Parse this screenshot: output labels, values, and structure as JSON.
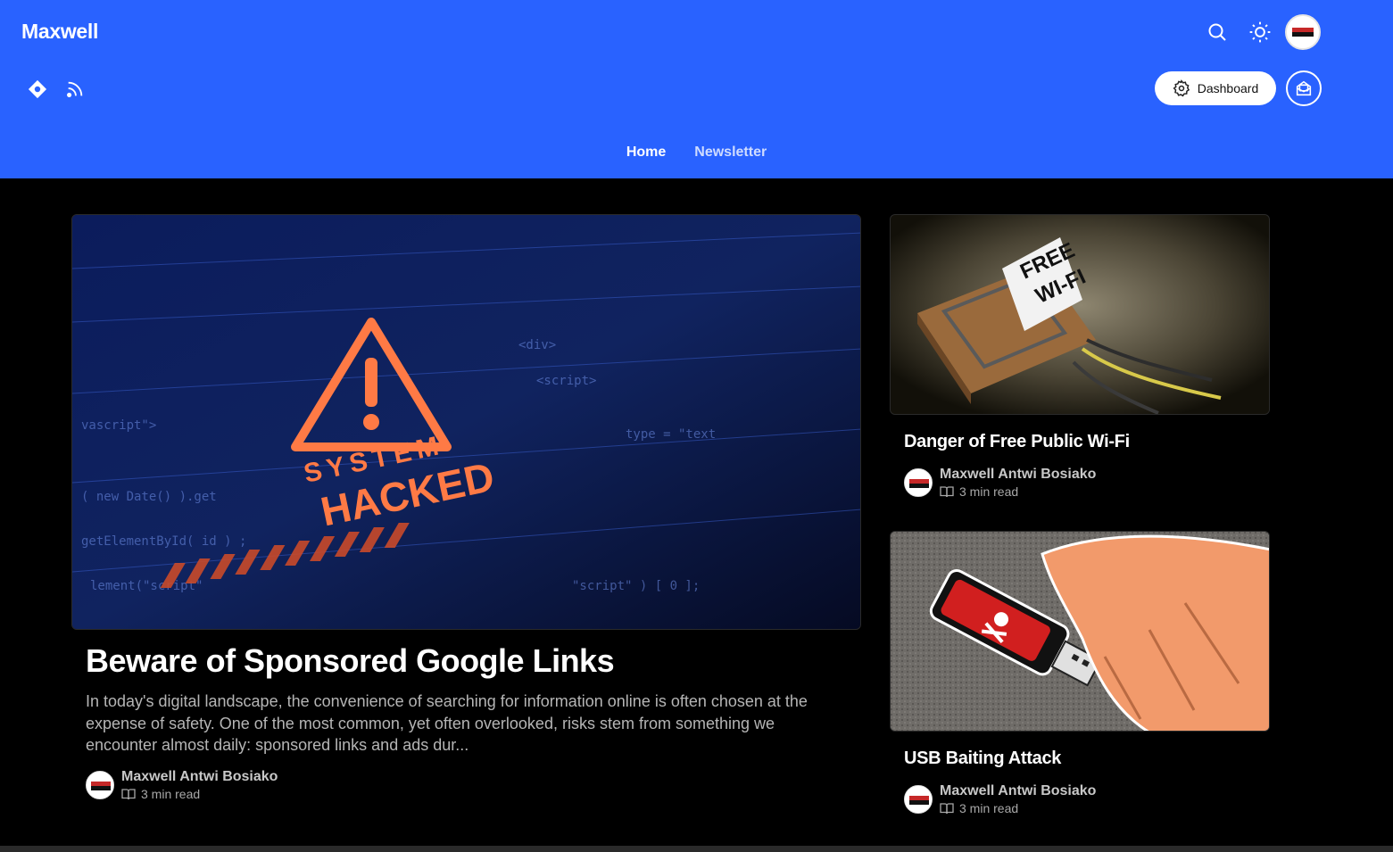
{
  "header": {
    "brand": "Maxwell",
    "dashboard_label": "Dashboard",
    "icons": [
      "search-icon",
      "sun-icon",
      "diamond-icon",
      "rss-icon",
      "gear-icon",
      "newsletter-icon"
    ],
    "bg_color": "#2962ff"
  },
  "nav": {
    "items": [
      {
        "label": "Home",
        "active": true
      },
      {
        "label": "Newsletter",
        "active": false
      }
    ]
  },
  "featured": {
    "title": "Beware of Sponsored Google Links",
    "excerpt": "In today's digital landscape, the convenience of searching for information online is often chosen at the expense of safety. One of the most common, yet often overlooked, risks stem from something we encounter almost daily: sponsored links and ads dur...",
    "author": "Maxwell Antwi Bosiako",
    "read_time": "3 min read",
    "image_text": [
      "SYSTEM",
      "HACKED"
    ]
  },
  "side_posts": [
    {
      "title": "Danger of Free Public Wi-Fi",
      "author": "Maxwell Antwi Bosiako",
      "read_time": "3 min read",
      "image_text": [
        "FREE",
        "WI-FI"
      ]
    },
    {
      "title": "USB Baiting Attack",
      "author": "Maxwell Antwi Bosiako",
      "read_time": "3 min read"
    }
  ]
}
